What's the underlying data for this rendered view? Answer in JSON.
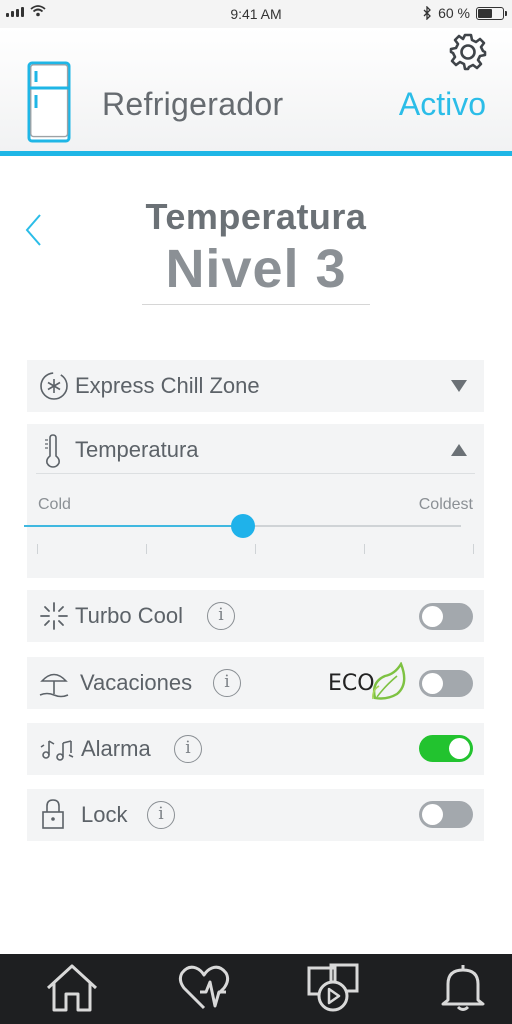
{
  "status_bar": {
    "time": "9:41 AM",
    "battery": "60 %",
    "battery_level": 0.6
  },
  "header": {
    "title": "Refrigerador",
    "status": "Activo",
    "accent": "#1fb6e6"
  },
  "page": {
    "title": "Temperatura",
    "level": "Nivel 3"
  },
  "express_chill": {
    "label": "Express Chill Zone",
    "expanded": false
  },
  "temperature": {
    "label": "Temperatura",
    "expanded": true,
    "slider": {
      "min_label": "Cold",
      "max_label": "Coldest",
      "value": 0.5
    }
  },
  "settings": [
    {
      "label": "Turbo Cool",
      "on": false,
      "icon": "turbo-icon"
    },
    {
      "label": "Vacaciones",
      "on": false,
      "icon": "beach-umbrella-icon",
      "badge": "ECO"
    },
    {
      "label": "Alarma",
      "on": true,
      "icon": "music-notes-icon"
    },
    {
      "label": "Lock",
      "on": false,
      "icon": "padlock-icon"
    }
  ],
  "info_glyph": "i",
  "nav": [
    "home-icon",
    "heart-pulse-icon",
    "media-icon",
    "bell-icon"
  ],
  "colors": {
    "toggle_on": "#22c32f",
    "toggle_off": "#a3a8ad",
    "slider": "#1fb2ea"
  }
}
